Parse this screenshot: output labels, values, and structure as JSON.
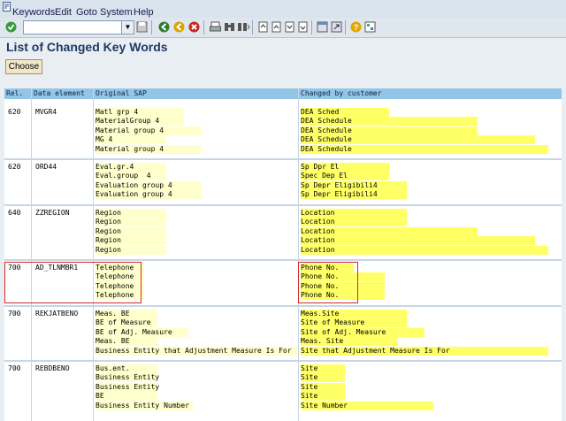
{
  "menu": [
    "Keywords",
    "Edit",
    "Goto",
    "System",
    "Help"
  ],
  "toolbar": {
    "command_value": "",
    "icons": [
      "enter-icon",
      "back-icon",
      "exit-icon",
      "cancel-icon",
      "save-icon",
      "print-icon",
      "find-icon",
      "find-next-icon",
      "first-page-icon",
      "prev-page-icon",
      "next-page-icon",
      "last-page-icon",
      "new-session-icon",
      "shortcut-icon",
      "help-icon",
      "layout-icon"
    ]
  },
  "page_title": "List of Changed Key Words",
  "choose_label": "Choose",
  "table": {
    "columns": [
      "Rel.",
      "Data element",
      "Original SAP",
      "Changed by customer"
    ],
    "groups": [
      {
        "rel": "620",
        "element": "MVGR4",
        "original": [
          "Matl grp 4",
          "MaterialGroup 4",
          "Material group 4",
          "MG 4",
          "Material group 4"
        ],
        "changed": [
          "DEA Sched",
          "DEA Schedule",
          "DEA Schedule",
          "DEA Schedule",
          "DEA Schedule"
        ]
      },
      {
        "rel": "620",
        "element": "ORD44",
        "original": [
          "Eval.gr.4",
          "Eval.group  4",
          "Evaluation group 4",
          "Evaluation group 4"
        ],
        "changed": [
          "Sp Dpr El",
          "Spec Dep El",
          "Sp Depr Eligibili4",
          "Sp Depr Eligibili4"
        ]
      },
      {
        "rel": "640",
        "element": "ZZREGION",
        "original": [
          "Region",
          "Region",
          "Region",
          "Region",
          "Region"
        ],
        "changed": [
          "Location",
          "Location",
          "Location",
          "Location",
          "Location"
        ]
      },
      {
        "rel": "700",
        "element": "AD_TLNMBR1",
        "original": [
          "Telephone",
          "Telephone",
          "Telephone",
          "Telephone"
        ],
        "changed": [
          "Phone No.",
          "Phone No.",
          "Phone No.",
          "Phone No."
        ]
      },
      {
        "rel": "700",
        "element": "REKJATBENO",
        "original": [
          "Meas. BE",
          "BE of Measure",
          "BE of Adj. Measure",
          "Meas. BE",
          "Business Entity that Adjustment Measure Is For"
        ],
        "changed": [
          "Meas.Site",
          "Site of Measure",
          "Site of Adj. Measure",
          "Meas. Site",
          "Site that Adjustment Measure Is For"
        ]
      },
      {
        "rel": "700",
        "element": "REBDBENO",
        "original": [
          "Bus.ent.",
          "Business Entity",
          "Business Entity",
          "BE",
          "Business Entity Number"
        ],
        "changed": [
          "Site",
          "Site",
          "Site",
          "Site",
          "Site Number"
        ]
      }
    ]
  },
  "colors": {
    "header": "#93c5e6",
    "highlight": "#ffff66",
    "highlight_light": "#ffffcc",
    "annotation": "#d42a2a"
  }
}
